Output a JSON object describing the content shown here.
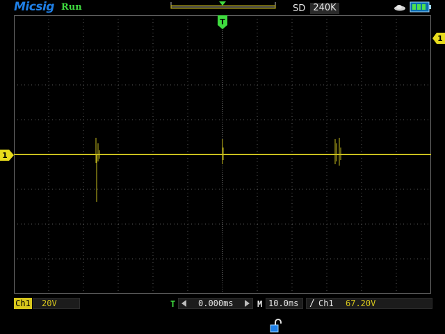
{
  "header": {
    "brand": "Micsig",
    "run_status": "Run",
    "storage_label": "SD",
    "memory_depth": "240K"
  },
  "channel1": {
    "marker": "1",
    "label": "Ch1",
    "scale": "20V",
    "color": "#d8c71c"
  },
  "trigger": {
    "marker_letter": "T",
    "level_marker": "1",
    "source": "Ch1",
    "level": "67.20V",
    "slope": "/",
    "color": "#3fdc3f"
  },
  "timebase": {
    "label": "T",
    "delay": "0.000ms",
    "m_label": "M",
    "scale": "10.0ms"
  },
  "icons": [
    "cloud-icon",
    "battery-icon",
    "lock-icon",
    "arrow-left-icon",
    "arrow-right-icon"
  ],
  "colors": {
    "brand": "#1f7fe6",
    "run": "#3fdc3f",
    "grid": "#5a5a5a",
    "trace": "#c8be1e"
  }
}
